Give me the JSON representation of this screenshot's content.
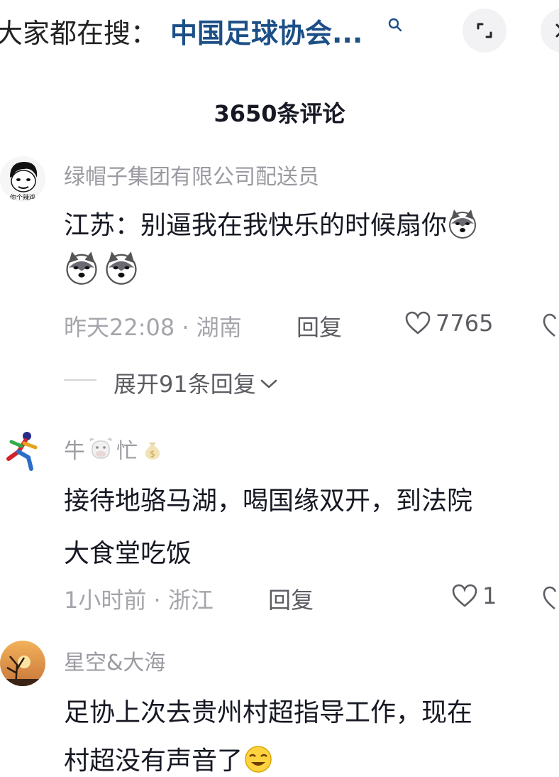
{
  "search": {
    "prefix": "大家都在搜：",
    "term": "中国足球协会..."
  },
  "header": {
    "comment_count": "3650条评论"
  },
  "icons": {
    "search": "search-icon",
    "expand": "expand-icon",
    "close": "close-icon",
    "like": "heart-icon"
  },
  "colors": {
    "link_blue": "#1c4f86",
    "muted_gray": "#9a9aa2",
    "text_dark": "#161823"
  },
  "comments": [
    {
      "username": "绿帽子集团有限公司配送员",
      "avatar_text": "你个辣鸡",
      "text_line1": "江苏：别逼我在我快乐的时候扇你",
      "time": "昨天22:08",
      "location": "湖南",
      "reply": "回复",
      "likes": "7765",
      "expand_replies": "展开91条回复"
    },
    {
      "username_part1": "牛",
      "username_part2": "忙",
      "text_line1": "接待地骆马湖，喝国缘双开，到法院",
      "text_line2": "大食堂吃饭",
      "time": "1小时前",
      "location": "浙江",
      "reply": "回复",
      "likes": "1"
    },
    {
      "username": "星空&大海",
      "text_line1": "足协上次去贵州村超指导工作，现在",
      "text_line2": "村超没有声音了"
    }
  ]
}
